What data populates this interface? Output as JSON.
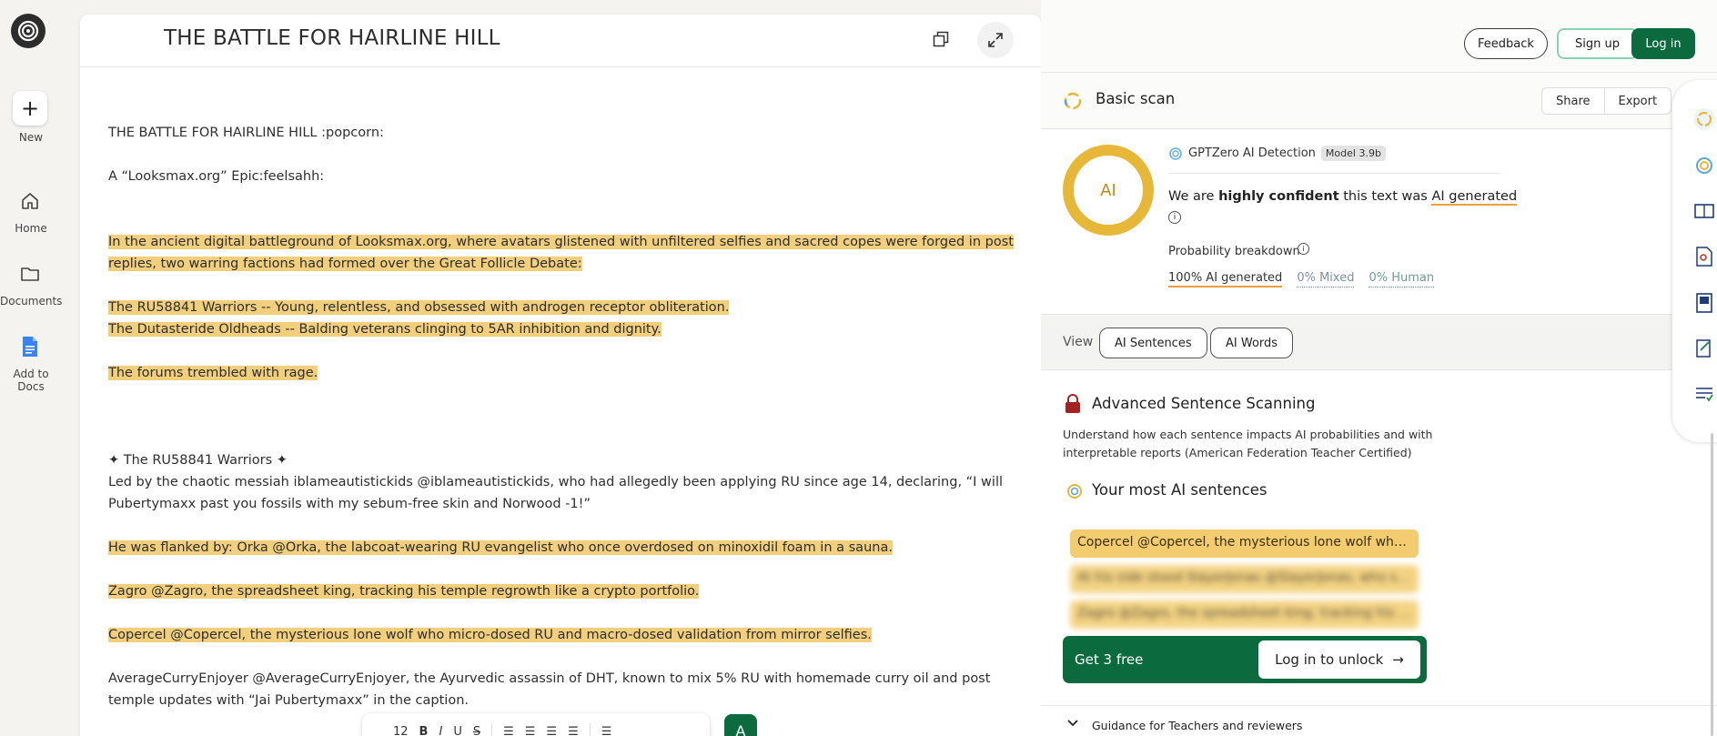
{
  "rail": {
    "new_label": "New",
    "home_label": "Home",
    "documents_label": "Documents",
    "add_docs_label": "Add to Docs"
  },
  "document": {
    "title": "THE BATTLE FOR HAIRLINE HILL",
    "paragraphs": [
      "THE BATTLE FOR HAIRLINE HILL :popcorn:",
      "A “Looksmax.org” Epic:feelsahh:",
      "In the ancient digital battleground of Looksmax.org, where avatars glistened with unfiltered selfies and sacred copes were forged in post replies, two warring factions had formed over the Great Follicle Debate:",
      "The RU58841 Warriors -- Young, relentless, and obsessed with androgen receptor obliteration.",
      "The Dutasteride Oldheads -- Balding veterans clinging to 5AR inhibition and dignity.",
      "The forums trembled with rage.",
      "✦ The RU58841 Warriors ✦",
      "Led by the chaotic messiah iblameautistickids @iblameautistickids, who had allegedly been applying RU since age 14, declaring, “I will Pubertymaxx past you fossils with my sebum-free skin and Norwood -1!”",
      "He was flanked by: Orka @Orka, the labcoat-wearing RU evangelist who once overdosed on minoxidil foam in a sauna.",
      "Zagro @Zagro, the spreadsheet king, tracking his temple regrowth like a crypto portfolio.",
      "Copercel @Copercel, the mysterious lone wolf who micro-dosed RU and macro-dosed validation from mirror selfies.",
      "AverageCurryEnjoyer @AverageCurryEnjoyer, the Ayurvedic assassin of DHT, known to mix 5% RU with homemade curry oil and post temple updates with “Jai Pubertymaxx” in the caption."
    ],
    "toolbar": {
      "font_size": "12",
      "bold": "B",
      "italic": "I",
      "underline": "U",
      "strike": "S",
      "ai_button": "A"
    }
  },
  "header": {
    "feedback": "Feedback",
    "signup": "Sign up",
    "login": "Log in"
  },
  "scan": {
    "title": "Basic scan",
    "share": "Share",
    "export": "Export",
    "ring_label": "AI",
    "detection_label": "GPTZero AI Detection",
    "model_badge": "Model 3.9b",
    "confidence_pre": "We are ",
    "confidence_bold": "highly confident",
    "confidence_mid": " this text was ",
    "confidence_result": "AI generated",
    "prob_title": "Probability breakdown",
    "prob_ai": "100% AI generated",
    "prob_mixed": "0% Mixed",
    "prob_human": "0% Human",
    "colors": {
      "ai": "#e7b838",
      "accent_green": "#0b6b3e"
    }
  },
  "view": {
    "label": "View",
    "sentences_btn": "AI Sentences",
    "words_btn": "AI Words"
  },
  "advanced": {
    "title": "Advanced Sentence Scanning",
    "description": "Understand how each sentence impacts AI probabilities and with interpretable reports (American Federation Teacher Certified)",
    "most_title": "Your most AI sentences",
    "sentences": [
      "Copercel @Copercel, the mysterious lone wolf who micro-dosed RU and macro-dosed validation from mirror selfies.",
      "At his side stood SlayerJonas @SlayerJonas, who swore by RU and ice baths.",
      "Zagro @Zagro, the spreadsheet king, tracking his temple regrowth like a crypto portfolio."
    ],
    "get_free": "Get 3 free",
    "unlock": "Log in to unlock",
    "guidance": "Guidance for Teachers and reviewers"
  }
}
